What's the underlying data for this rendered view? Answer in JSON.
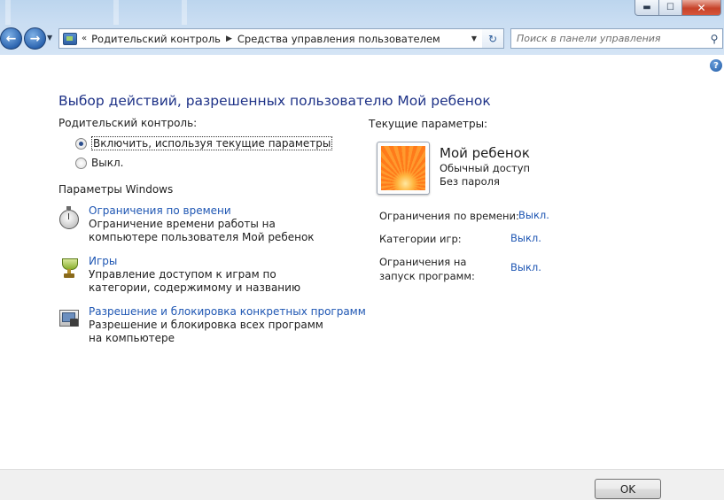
{
  "window": {
    "minimize_label": "▬",
    "maximize_label": "☐",
    "close_label": "✕"
  },
  "nav": {
    "back_label": "←",
    "forward_label": "→",
    "recent_label": "▼"
  },
  "address": {
    "chevrons": "«",
    "crumbs": [
      "Родительский контроль",
      "Средства управления пользователем"
    ],
    "separator": "▶",
    "dropdown": "▼"
  },
  "refresh_label": "↻",
  "search": {
    "placeholder": "Поиск в панели управления",
    "value": "",
    "icon_glyph": "⚲"
  },
  "help_label": "?",
  "page": {
    "title": "Выбор действий, разрешенных пользователю Мой ребенок",
    "parental_control_label": "Родительский контроль:",
    "radio_on": "Включить, используя текущие параметры",
    "radio_off": "Выкл.",
    "radio_selected": "on",
    "windows_settings_label": "Параметры Windows"
  },
  "tasks": [
    {
      "link": "Ограничения по времени",
      "description": "Ограничение времени работы на компьютере пользователя Мой ребенок",
      "icon": "stopwatch-icon"
    },
    {
      "link": "Игры",
      "description": "Управление доступом к играм по категории, содержимому и названию",
      "icon": "trophy-icon"
    },
    {
      "link": "Разрешение и блокировка конкретных программ",
      "description": "Разрешение и блокировка всех программ на компьютере",
      "icon": "programs-icon"
    }
  ],
  "current": {
    "label": "Текущие параметры:",
    "user_name": "Мой ребенок",
    "account_type": "Обычный доступ",
    "password_status": "Без пароля",
    "settings": [
      {
        "label": "Ограничения по времени:",
        "value": "Выкл."
      },
      {
        "label": "Категории игр:",
        "value": "Выкл."
      },
      {
        "label": "Ограничения на запуск программ:",
        "value": "Выкл."
      }
    ]
  },
  "footer": {
    "ok_label": "OK"
  },
  "colors": {
    "link": "#1e56b3",
    "title": "#1e3287",
    "chrome": "#c9ddf2"
  }
}
